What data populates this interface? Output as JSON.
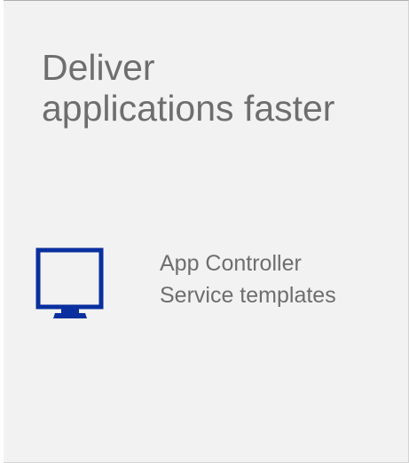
{
  "card": {
    "title_lines": [
      "Deliver",
      "applications faster"
    ],
    "icon": "monitor-icon",
    "features": [
      "App Controller",
      "Service templates"
    ]
  },
  "colors": {
    "background": "#f2f2f2",
    "text": "#6e6e6e",
    "icon": "#0a2f9e"
  }
}
